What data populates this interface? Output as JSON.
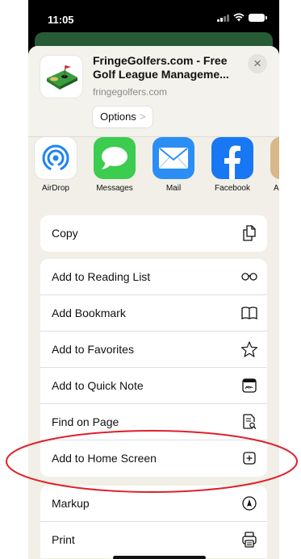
{
  "status_bar": {
    "time": "11:05"
  },
  "share_header": {
    "title": "FringeGolfers.com - Free Golf League Manageme...",
    "url": "fringegolfers.com",
    "options_label": "Options",
    "options_chevron": ">",
    "close_symbol": "×"
  },
  "apps": [
    {
      "label": "AirDrop",
      "icon": "airdrop-icon"
    },
    {
      "label": "Messages",
      "icon": "messages-icon"
    },
    {
      "label": "Mail",
      "icon": "mail-icon"
    },
    {
      "label": "Facebook",
      "icon": "facebook-icon"
    },
    {
      "label": "Ar",
      "icon": "partial-app-icon"
    }
  ],
  "actions": {
    "copy": {
      "label": "Copy",
      "icon": "copy-icon"
    },
    "list": [
      {
        "label": "Add to Reading List",
        "icon": "glasses-icon"
      },
      {
        "label": "Add Bookmark",
        "icon": "book-icon"
      },
      {
        "label": "Add to Favorites",
        "icon": "star-icon"
      },
      {
        "label": "Add to Quick Note",
        "icon": "quick-note-icon"
      },
      {
        "label": "Find on Page",
        "icon": "find-page-icon"
      },
      {
        "label": "Add to Home Screen",
        "icon": "plus-square-icon"
      }
    ],
    "bottom": [
      {
        "label": "Markup",
        "icon": "markup-icon"
      },
      {
        "label": "Print",
        "icon": "print-icon"
      }
    ]
  },
  "colors": {
    "annotation": "#e0202a",
    "sheet_background": "#f1efe7",
    "airdrop_blue": "#1e84f0",
    "messages_green": "#3ccc4f",
    "mail_blue": "#2a8ef5",
    "facebook_blue": "#1877f2"
  }
}
